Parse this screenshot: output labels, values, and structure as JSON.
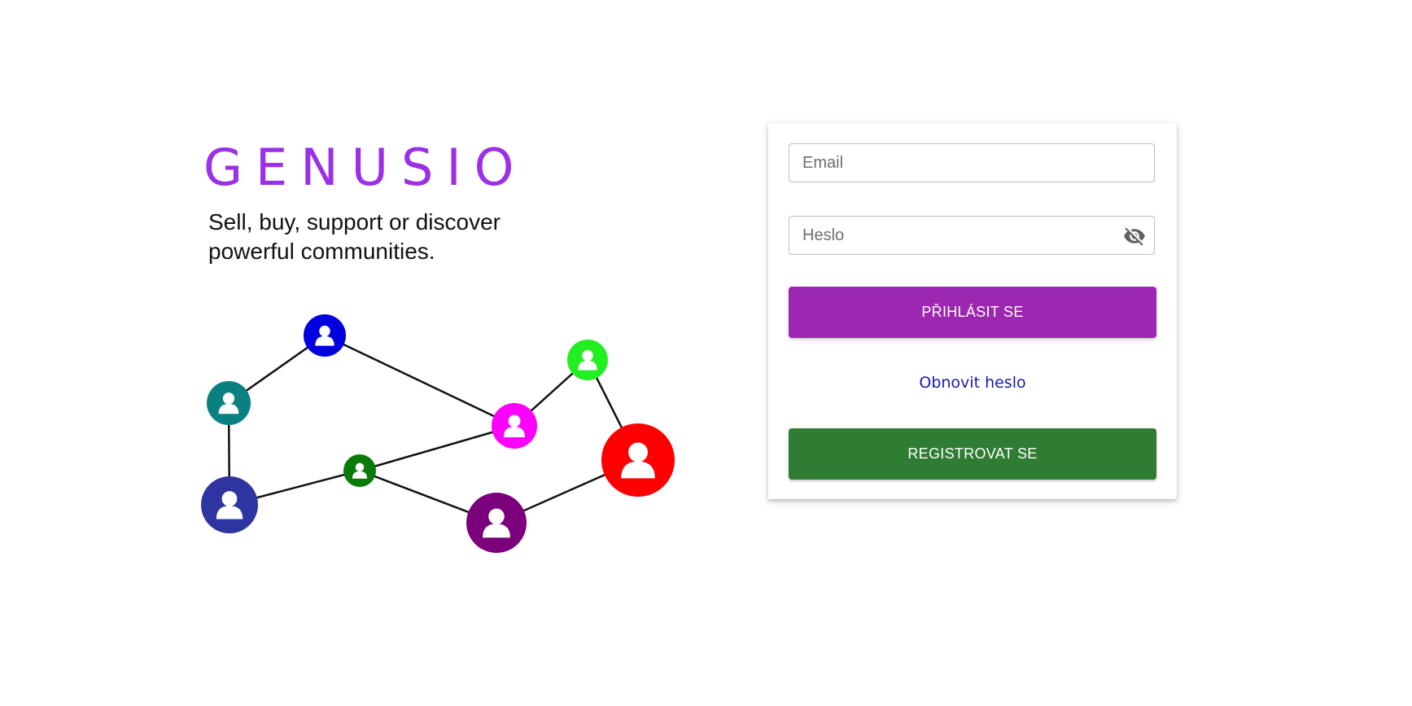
{
  "brand": {
    "logo_text": "GENUSIO",
    "tagline": "Sell, buy, support or discover powerful communities.",
    "logo_color": "#9b30e6"
  },
  "illustration": {
    "name": "community-network",
    "node_colors": [
      "#0000e0",
      "#0a8080",
      "#2e35a0",
      "#0a7a0a",
      "#ff00ff",
      "#22ee22",
      "#7b007b",
      "#ff0000"
    ]
  },
  "login_form": {
    "email_placeholder": "Email",
    "email_value": "",
    "password_placeholder": "Heslo",
    "password_value": "",
    "password_toggle_icon": "eye-off-icon",
    "login_button": "PŘIHLÁSIT SE",
    "reset_link": "Obnovit heslo",
    "register_button": "REGISTROVAT SE"
  },
  "colors": {
    "login_button": "#9c27b0",
    "register_button": "#2e7d32",
    "link": "#1a1aa6"
  }
}
